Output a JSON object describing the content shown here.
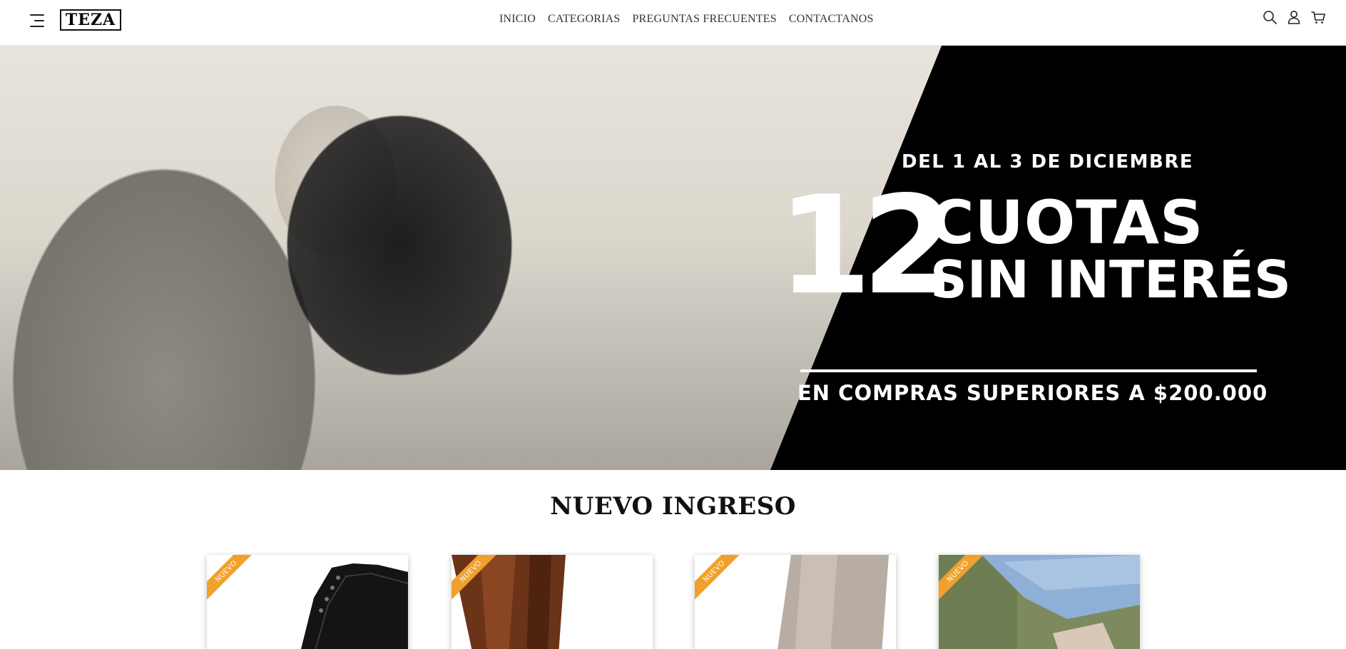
{
  "header": {
    "logo_text": "TEZA",
    "nav": [
      "INICIO",
      "CATEGORIAS",
      "PREGUNTAS FRECUENTES",
      "CONTACTANOS"
    ]
  },
  "hero": {
    "subtitle": "DEL 1 AL 3 DE DICIEMBRE",
    "number": "12",
    "line1": "CUOTAS",
    "line2": "SIN INTERÉS",
    "bottom": "EN COMPRAS SUPERIORES A $200.000"
  },
  "section": {
    "title": "NUEVO INGRESO"
  },
  "products": [
    {
      "badge": "NUEVO"
    },
    {
      "badge": "NUEVO"
    },
    {
      "badge": "NUEVO"
    },
    {
      "badge": "NUEVO"
    }
  ],
  "colors": {
    "badge": "#f0a02c",
    "hero_bg": "#000000"
  }
}
